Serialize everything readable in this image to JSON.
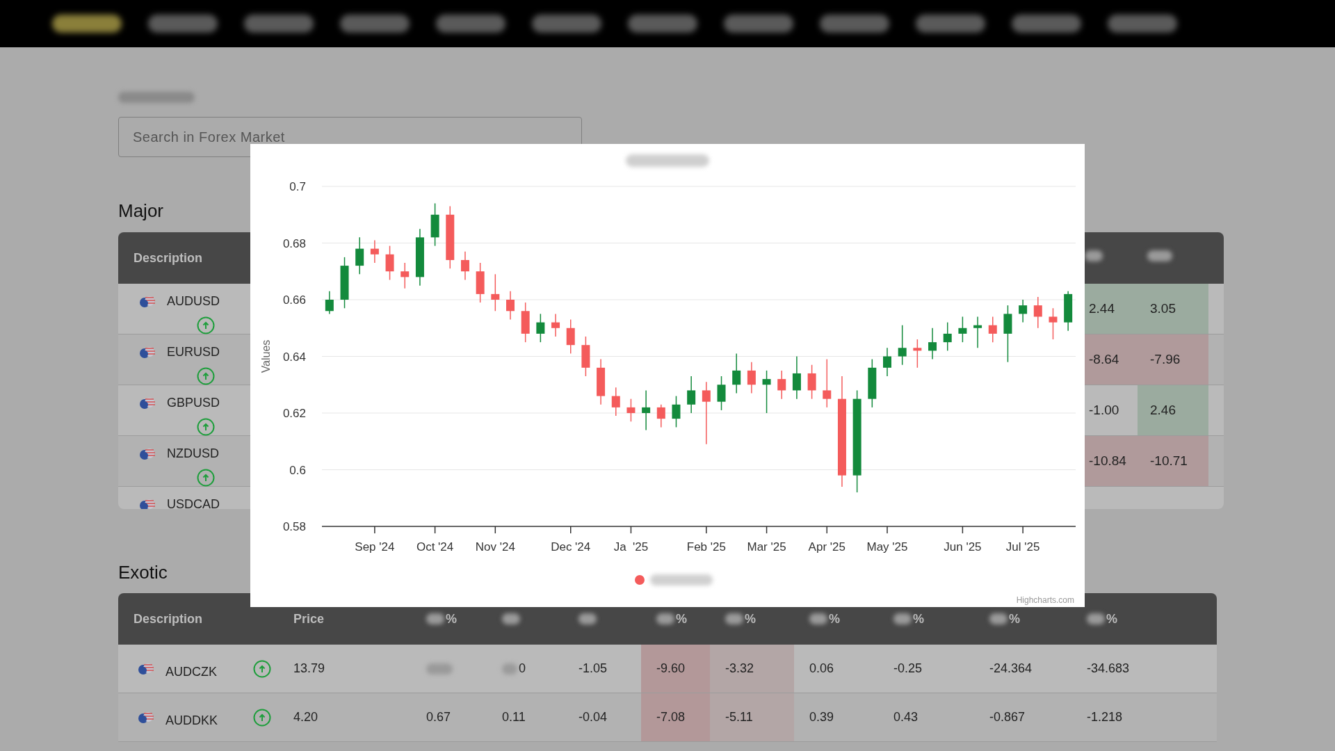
{
  "nav": {
    "items": [
      {
        "selected": true
      },
      {
        "selected": false
      },
      {
        "selected": false
      },
      {
        "selected": false
      },
      {
        "selected": false
      },
      {
        "selected": false
      },
      {
        "selected": false
      },
      {
        "selected": false
      },
      {
        "selected": false
      },
      {
        "selected": false
      },
      {
        "selected": false
      },
      {
        "selected": false
      }
    ]
  },
  "search": {
    "placeholder": "Search in Forex Market"
  },
  "major": {
    "title": "Major",
    "columns": [
      "Description"
    ],
    "rows": [
      {
        "name": "AUDUSD",
        "rising": true,
        "cells": [
          {
            "text": "2.44",
            "color": "#9bab9f"
          },
          {
            "text": "3.05",
            "color": "#9bab9f"
          }
        ]
      },
      {
        "name": "EURUSD",
        "rising": true,
        "cells": [
          {
            "text": "-8.64",
            "color": "#b09a9b"
          },
          {
            "text": "-7.96",
            "color": "#b09a9b"
          }
        ]
      },
      {
        "name": "GBPUSD",
        "rising": true,
        "cells": [
          {
            "text": "-1.00"
          },
          {
            "text": "2.46",
            "color": "#9bab9f"
          }
        ]
      },
      {
        "name": "NZDUSD",
        "rising": true,
        "cells": [
          {
            "text": "-10.84",
            "color": "#b09a9b"
          },
          {
            "text": "-10.71",
            "color": "#b09a9b"
          }
        ]
      },
      {
        "name": "USDCAD",
        "cells": []
      }
    ]
  },
  "exotic": {
    "title": "Exotic",
    "columns": [
      {
        "label": "Description",
        "redacted": false
      },
      {
        "label": "Price",
        "redacted": false
      },
      {
        "label": "%",
        "redacted": true
      },
      {
        "redacted": true
      },
      {
        "redacted": true
      },
      {
        "label": "%",
        "redacted": true
      },
      {
        "label": "%",
        "redacted": true
      },
      {
        "label": "%",
        "redacted": true
      },
      {
        "label": "%",
        "redacted": true
      },
      {
        "label": "%",
        "redacted": true
      },
      {
        "label": "%",
        "redacted": true
      }
    ],
    "rows": [
      {
        "cells": [
          {
            "kind": "pair",
            "text": "AUDCZK",
            "rising": true
          },
          {
            "text": "13.79"
          },
          {
            "redacted": true
          },
          {
            "text": "0",
            "redacted": true
          },
          {
            "text": "-1.05"
          },
          {
            "text": "-9.60",
            "color": "#b39899"
          },
          {
            "text": "-3.32",
            "color": "#b3a6a6"
          },
          {
            "text": "0.06"
          },
          {
            "text": "-0.25"
          },
          {
            "text": "-24.364"
          },
          {
            "text": "-34.683"
          }
        ]
      },
      {
        "cells": [
          {
            "kind": "pair",
            "text": "AUDDKK",
            "rising": true
          },
          {
            "text": "4.20"
          },
          {
            "text": "0.67"
          },
          {
            "text": "0.11"
          },
          {
            "text": "-0.04"
          },
          {
            "text": "-7.08",
            "color": "#b39899"
          },
          {
            "text": "-5.11",
            "color": "#b3a6a6"
          },
          {
            "text": "0.39"
          },
          {
            "text": "0.43"
          },
          {
            "text": "-0.867"
          },
          {
            "text": "-1.218"
          }
        ]
      }
    ]
  },
  "modal": {
    "credit": "Highcharts.com",
    "legend": {
      "color": "#f45b5b"
    },
    "chart_data": {
      "type": "candlestick",
      "ylabel": "Values",
      "ylim": [
        0.58,
        0.7
      ],
      "yticks": [
        {
          "value": 0.58,
          "label": "0.58"
        },
        {
          "value": 0.6,
          "label": "0.6"
        },
        {
          "value": 0.62,
          "label": "0.62"
        },
        {
          "value": 0.64,
          "label": "0.64"
        },
        {
          "value": 0.66,
          "label": "0.66"
        },
        {
          "value": 0.68,
          "label": "0.68"
        },
        {
          "value": 0.7,
          "label": "0.7"
        }
      ],
      "categories": [
        null,
        null,
        null,
        "Sep '24",
        null,
        null,
        null,
        "Oct '24",
        null,
        null,
        null,
        "Nov '24",
        null,
        null,
        null,
        null,
        "Dec '24",
        null,
        null,
        null,
        "Ja  '25",
        null,
        null,
        null,
        null,
        "Feb '25",
        null,
        null,
        null,
        "Mar '25",
        null,
        null,
        null,
        "Apr '25",
        null,
        null,
        null,
        "May '25",
        null,
        null,
        null,
        null,
        "Jun '25",
        null,
        null,
        null,
        "Jul '25",
        null,
        null,
        null
      ],
      "grid": true,
      "series": [
        {
          "ohlc": [
            [
              0.656,
              0.663,
              0.655,
              0.66
            ],
            [
              0.66,
              0.675,
              0.657,
              0.672
            ],
            [
              0.672,
              0.682,
              0.669,
              0.678
            ],
            [
              0.678,
              0.681,
              0.673,
              0.676
            ],
            [
              0.676,
              0.679,
              0.667,
              0.67
            ],
            [
              0.67,
              0.673,
              0.664,
              0.668
            ],
            [
              0.668,
              0.685,
              0.665,
              0.682
            ],
            [
              0.682,
              0.694,
              0.679,
              0.69
            ],
            [
              0.69,
              0.693,
              0.671,
              0.674
            ],
            [
              0.674,
              0.677,
              0.667,
              0.67
            ],
            [
              0.67,
              0.673,
              0.659,
              0.662
            ],
            [
              0.662,
              0.669,
              0.656,
              0.66
            ],
            [
              0.66,
              0.663,
              0.653,
              0.656
            ],
            [
              0.656,
              0.659,
              0.645,
              0.648
            ],
            [
              0.648,
              0.655,
              0.645,
              0.652
            ],
            [
              0.652,
              0.655,
              0.647,
              0.65
            ],
            [
              0.65,
              0.653,
              0.641,
              0.644
            ],
            [
              0.644,
              0.647,
              0.633,
              0.636
            ],
            [
              0.636,
              0.639,
              0.623,
              0.626
            ],
            [
              0.626,
              0.629,
              0.619,
              0.622
            ],
            [
              0.622,
              0.625,
              0.617,
              0.62
            ],
            [
              0.62,
              0.628,
              0.614,
              0.622
            ],
            [
              0.622,
              0.623,
              0.615,
              0.618
            ],
            [
              0.618,
              0.626,
              0.615,
              0.623
            ],
            [
              0.623,
              0.633,
              0.62,
              0.628
            ],
            [
              0.628,
              0.631,
              0.609,
              0.624
            ],
            [
              0.624,
              0.633,
              0.621,
              0.63
            ],
            [
              0.63,
              0.641,
              0.627,
              0.635
            ],
            [
              0.635,
              0.638,
              0.627,
              0.63
            ],
            [
              0.63,
              0.635,
              0.62,
              0.632
            ],
            [
              0.632,
              0.635,
              0.625,
              0.628
            ],
            [
              0.628,
              0.64,
              0.625,
              0.634
            ],
            [
              0.634,
              0.637,
              0.625,
              0.628
            ],
            [
              0.628,
              0.639,
              0.622,
              0.625
            ],
            [
              0.625,
              0.633,
              0.594,
              0.598
            ],
            [
              0.598,
              0.628,
              0.592,
              0.625
            ],
            [
              0.625,
              0.639,
              0.622,
              0.636
            ],
            [
              0.636,
              0.643,
              0.633,
              0.64
            ],
            [
              0.64,
              0.651,
              0.637,
              0.643
            ],
            [
              0.643,
              0.646,
              0.636,
              0.642
            ],
            [
              0.642,
              0.65,
              0.639,
              0.645
            ],
            [
              0.645,
              0.652,
              0.642,
              0.648
            ],
            [
              0.648,
              0.654,
              0.645,
              0.65
            ],
            [
              0.65,
              0.654,
              0.643,
              0.651
            ],
            [
              0.651,
              0.654,
              0.645,
              0.648
            ],
            [
              0.648,
              0.658,
              0.638,
              0.655
            ],
            [
              0.655,
              0.66,
              0.652,
              0.658
            ],
            [
              0.658,
              0.661,
              0.65,
              0.654
            ],
            [
              0.654,
              0.657,
              0.646,
              0.652
            ],
            [
              0.652,
              0.663,
              0.649,
              0.662
            ]
          ]
        }
      ]
    }
  }
}
